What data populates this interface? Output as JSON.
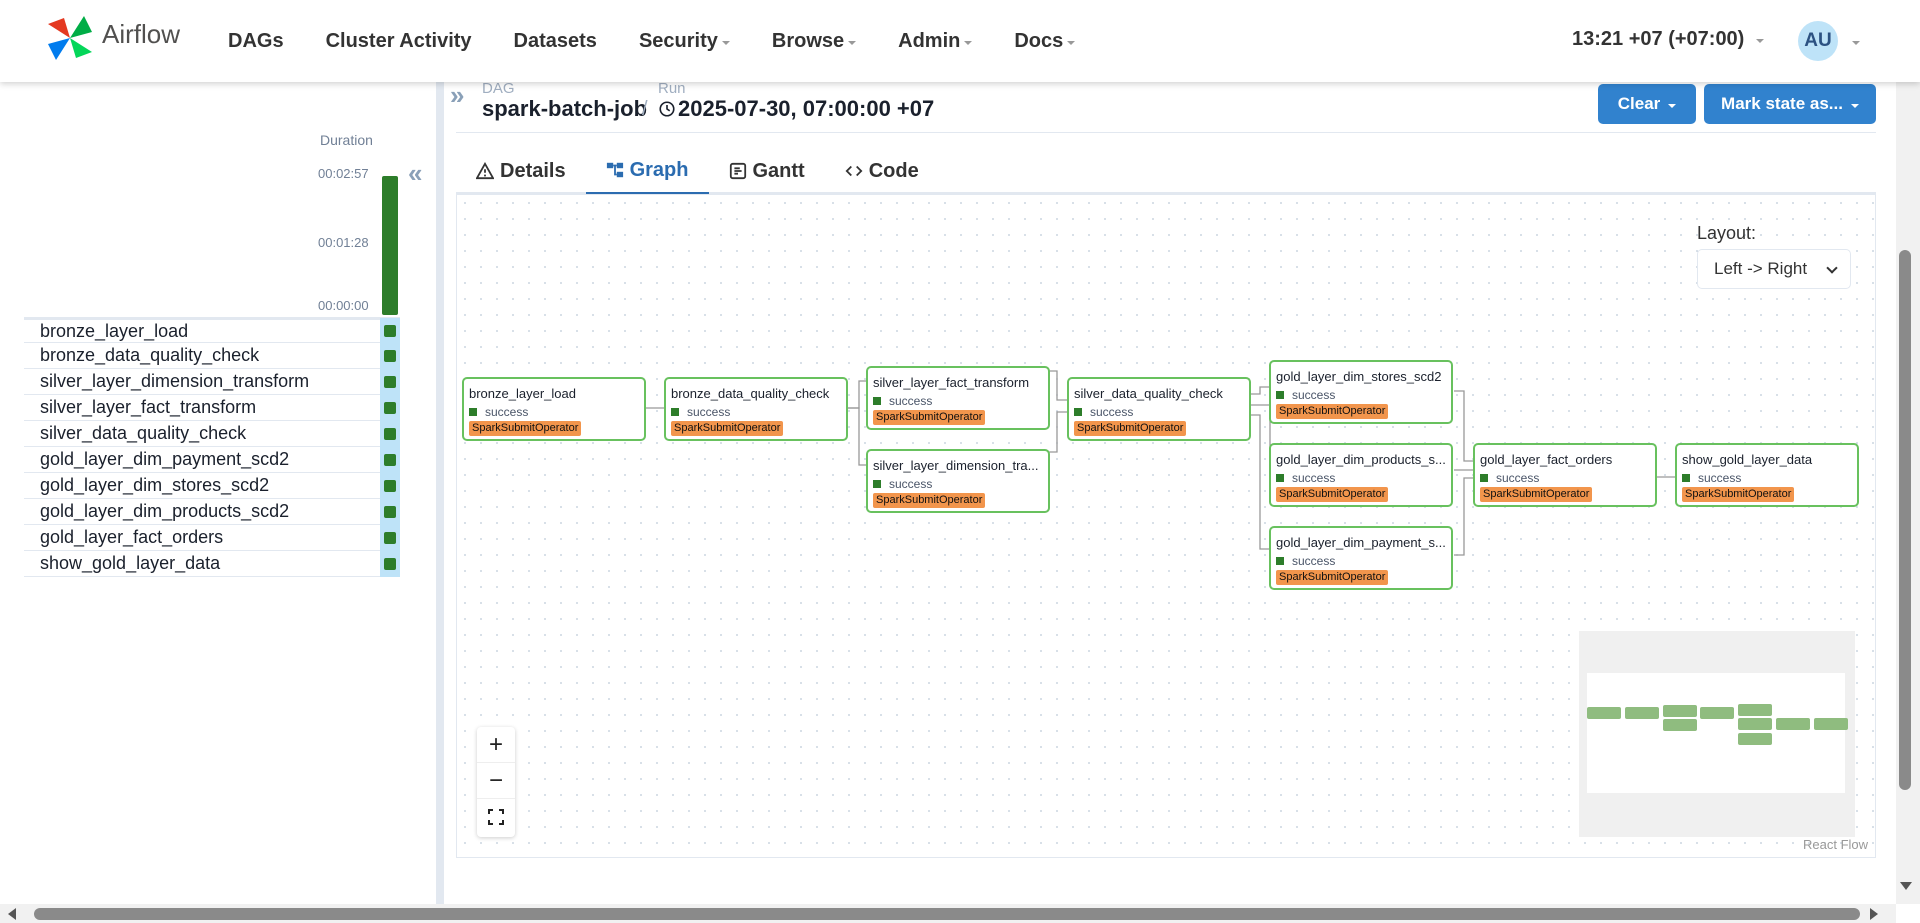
{
  "nav": {
    "logo_text": "Airflow",
    "items": [
      "DAGs",
      "Cluster Activity",
      "Datasets",
      "Security",
      "Browse",
      "Admin",
      "Docs"
    ],
    "time": "13:21 +07 (+07:00)",
    "avatar_initials": "AU"
  },
  "left": {
    "duration_label": "Duration",
    "ticks": [
      "00:02:57",
      "00:01:28",
      "00:00:00"
    ],
    "tasks": [
      "bronze_layer_load",
      "bronze_data_quality_check",
      "silver_layer_dimension_transform",
      "silver_layer_fact_transform",
      "silver_data_quality_check",
      "gold_layer_dim_payment_scd2",
      "gold_layer_dim_stores_scd2",
      "gold_layer_dim_products_scd2",
      "gold_layer_fact_orders",
      "show_gold_layer_data"
    ]
  },
  "breadcrumb": {
    "dag_label": "DAG",
    "dag": "spark-batch-job",
    "separator": "/",
    "run_label": "Run",
    "run": "2025-07-30, 07:00:00 +07"
  },
  "actions": {
    "clear": "Clear",
    "mark_state": "Mark state as..."
  },
  "tabs": [
    "Details",
    "Graph",
    "Gantt",
    "Code"
  ],
  "graph": {
    "layout_label": "Layout:",
    "layout_value": "Left -> Right",
    "nodes": [
      {
        "id": "bronze_layer_load",
        "title": "bronze_layer_load",
        "status": "success",
        "operator": "SparkSubmitOperator"
      },
      {
        "id": "bronze_data_quality_check",
        "title": "bronze_data_quality_check",
        "status": "success",
        "operator": "SparkSubmitOperator"
      },
      {
        "id": "silver_layer_fact_transform",
        "title": "silver_layer_fact_transform",
        "status": "success",
        "operator": "SparkSubmitOperator"
      },
      {
        "id": "silver_layer_dimension_transform",
        "title": "silver_layer_dimension_tra...",
        "status": "success",
        "operator": "SparkSubmitOperator"
      },
      {
        "id": "silver_data_quality_check",
        "title": "silver_data_quality_check",
        "status": "success",
        "operator": "SparkSubmitOperator"
      },
      {
        "id": "gold_layer_dim_stores_scd2",
        "title": "gold_layer_dim_stores_scd2",
        "status": "success",
        "operator": "SparkSubmitOperator"
      },
      {
        "id": "gold_layer_dim_products_scd2",
        "title": "gold_layer_dim_products_s...",
        "status": "success",
        "operator": "SparkSubmitOperator"
      },
      {
        "id": "gold_layer_dim_payment_scd2",
        "title": "gold_layer_dim_payment_s...",
        "status": "success",
        "operator": "SparkSubmitOperator"
      },
      {
        "id": "gold_layer_fact_orders",
        "title": "gold_layer_fact_orders",
        "status": "success",
        "operator": "SparkSubmitOperator"
      },
      {
        "id": "show_gold_layer_data",
        "title": "show_gold_layer_data",
        "status": "success",
        "operator": "SparkSubmitOperator"
      }
    ],
    "attribution": "React Flow"
  },
  "colors": {
    "success": "#2d7d2a",
    "node_border": "#68c15e",
    "operator_badge": "#f2954c",
    "primary_button": "#3182ce"
  }
}
